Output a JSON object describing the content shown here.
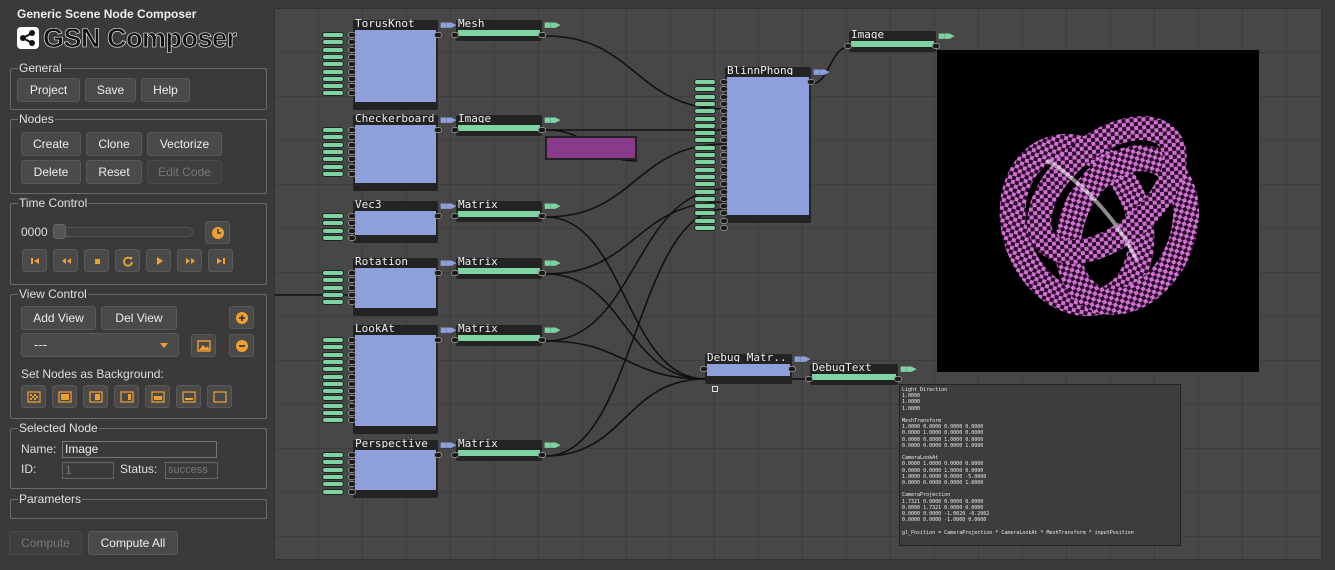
{
  "app": {
    "title": "Generic Scene Node Composer",
    "logo_text": "GSN Composer"
  },
  "general": {
    "legend": "General",
    "buttons": [
      "Project",
      "Save",
      "Help"
    ]
  },
  "nodes_panel": {
    "legend": "Nodes",
    "create": "Create",
    "clone": "Clone",
    "vectorize": "Vectorize",
    "delete": "Delete",
    "reset": "Reset",
    "edit_code": "Edit Code"
  },
  "time_control": {
    "legend": "Time Control",
    "frame": "0000"
  },
  "view_control": {
    "legend": "View Control",
    "add_view": "Add View",
    "del_view": "Del View",
    "view_select": "---",
    "bg_label": "Set Nodes as Background:"
  },
  "selected_node": {
    "legend": "Selected Node",
    "name_label": "Name:",
    "name_value": "Image",
    "id_label": "ID:",
    "id_value": "1",
    "status_label": "Status:",
    "status_value": "success"
  },
  "parameters": {
    "legend": "Parameters"
  },
  "compute": {
    "compute": "Compute",
    "compute_all": "Compute All"
  },
  "graph": {
    "nodes": [
      {
        "title": "TorusKnot"
      },
      {
        "title": "Mesh"
      },
      {
        "title": "Checkerboard"
      },
      {
        "title": "Image"
      },
      {
        "title": "Vec3"
      },
      {
        "title": "Matrix"
      },
      {
        "title": "Rotation"
      },
      {
        "title": "Matrix"
      },
      {
        "title": "LookAt"
      },
      {
        "title": "Matrix"
      },
      {
        "title": "Perspective"
      },
      {
        "title": "Matrix"
      },
      {
        "title": "BlinnPhong"
      },
      {
        "title": "Image"
      },
      {
        "title": "Debug Matr.."
      },
      {
        "title": "DebugText"
      }
    ],
    "debug_output": "Light Direction\n1.0000\n1.0000\n1.0000\n\nMeshTransform\n1.0000 0.0000 0.0000 0.0000\n0.0000 1.0000 0.0000 0.0000\n0.0000 0.0000 1.0000 0.0000\n0.0000 0.0000 0.0000 1.0000\n\nCameraLookAt\n0.0000 1.0000 0.0000 0.0000\n0.0000 0.0000 1.0000 0.0000\n1.0000 0.0000 0.0000 -5.0000\n0.0000 0.0000 0.0000 1.0000\n\nCameraProjection\n1.7321 0.0000 0.0000 0.0000\n0.0000 1.7321 0.0000 0.0000\n0.0000 0.0000 -1.0020 -0.2002\n0.0000 0.0000 -1.0000 0.0000\n\ngl_Position = CameraProjection * CameraLookAt * MeshTransform * inputPosition",
    "colors": {
      "node_body": "#8ea0dc",
      "matrix_body": "#7ed4a0",
      "checker_swatch": "#8a3a8a",
      "torus_pink": "#d070d0",
      "accent": "#f0a030"
    }
  }
}
